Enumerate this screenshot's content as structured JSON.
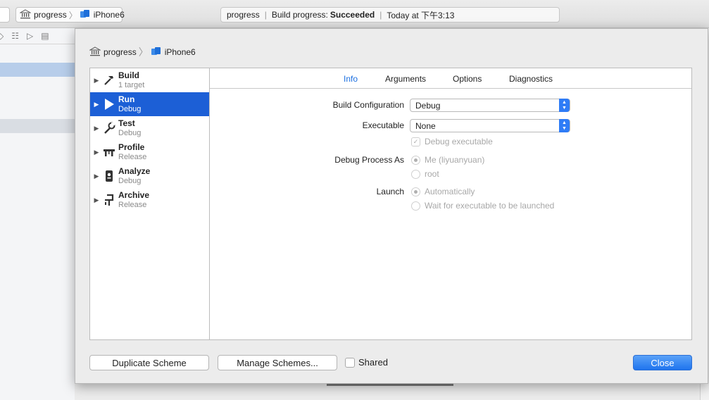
{
  "toolbar": {
    "scheme": "progress",
    "destination": "iPhone6",
    "status": {
      "project": "progress",
      "label": "Build progress:",
      "result": "Succeeded",
      "time": "Today at 下午3:13"
    }
  },
  "sheet": {
    "breadcrumb": {
      "scheme": "progress",
      "destination": "iPhone6"
    },
    "actions": [
      {
        "name": "Build",
        "sub": "1 target",
        "icon": "hammer-icon"
      },
      {
        "name": "Run",
        "sub": "Debug",
        "icon": "play-icon"
      },
      {
        "name": "Test",
        "sub": "Debug",
        "icon": "wrench-icon"
      },
      {
        "name": "Profile",
        "sub": "Release",
        "icon": "caliper-icon"
      },
      {
        "name": "Analyze",
        "sub": "Debug",
        "icon": "analyze-icon"
      },
      {
        "name": "Archive",
        "sub": "Release",
        "icon": "archive-icon"
      }
    ],
    "selected_action": "Run",
    "tabs": [
      "Info",
      "Arguments",
      "Options",
      "Diagnostics"
    ],
    "active_tab": "Info",
    "form": {
      "build_configuration_label": "Build Configuration",
      "build_configuration_value": "Debug",
      "executable_label": "Executable",
      "executable_value": "None",
      "debug_executable": "Debug executable",
      "debug_process_label": "Debug Process As",
      "debug_process_me": "Me (liyuanyuan)",
      "debug_process_root": "root",
      "launch_label": "Launch",
      "launch_auto": "Automatically",
      "launch_wait": "Wait for executable to be launched"
    },
    "buttons": {
      "duplicate": "Duplicate Scheme",
      "manage": "Manage Schemes...",
      "shared": "Shared",
      "close": "Close"
    }
  },
  "colors": {
    "accent": "#1c5fd6",
    "tab_active": "#1b6fe0"
  }
}
